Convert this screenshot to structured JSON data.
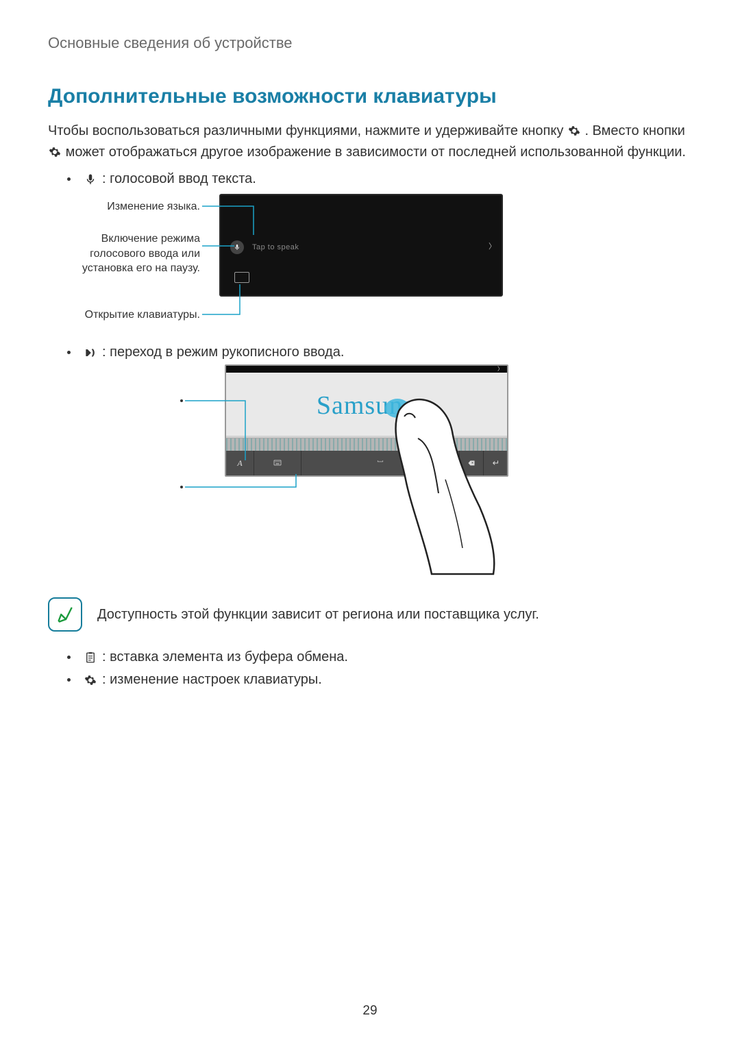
{
  "header": "Основные сведения об устройстве",
  "title": "Дополнительные возможности клавиатуры",
  "intro": {
    "seg1": "Чтобы воспользоваться различными функциями, нажмите и удерживайте кнопку ",
    "seg2": ". Вместо кнопки ",
    "seg3": " может отображаться другое изображение в зависимости от последней использованной функции."
  },
  "bullets": {
    "mic": ": голосовой ввод текста.",
    "hand": ": переход в режим рукописного ввода.",
    "clip": ": вставка элемента из буфера обмена.",
    "gear": ": изменение настроек клавиатуры."
  },
  "fig1": {
    "c1": "Изменение языка.",
    "c2": "Включение режима голосового ввода или установка его на паузу.",
    "c3": "Открытие клавиатуры.",
    "tap_to_speak": "Tap to speak"
  },
  "fig2": {
    "samsung": "Samsung",
    "key_a": "A",
    "key_space": "⎵",
    "key_back": "⌫",
    "key_enter": "↵"
  },
  "note": "Доступность этой функции зависит от региона или поставщика услуг.",
  "page": "29"
}
